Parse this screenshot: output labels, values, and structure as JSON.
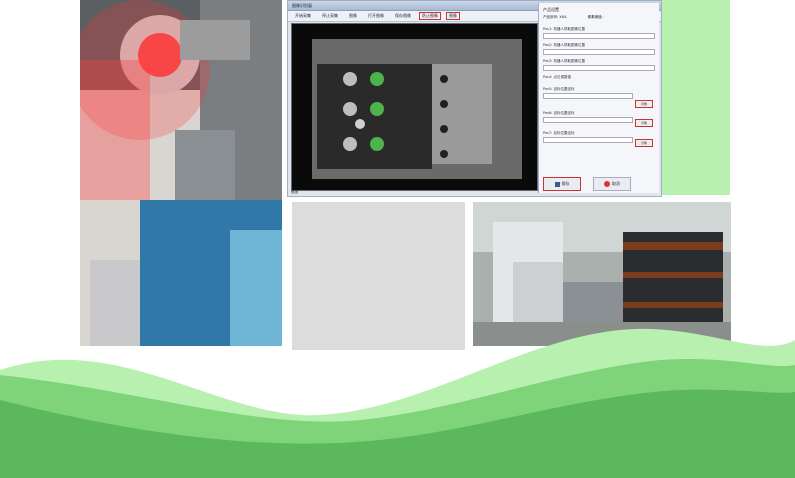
{
  "app": {
    "title": "图像识别窗",
    "menu": [
      "开始采集",
      "停止采集",
      "图像",
      "打开图像",
      "保存图像",
      "防止图像",
      "图像"
    ],
    "panel_header": "产品设置",
    "product_label": "产品序列:",
    "product_value": "XXA",
    "threshold_label": "像素阈值:",
    "fields": [
      {
        "label": "Pos1: 机器人抓取图像位置",
        "value": ""
      },
      {
        "label": "Pos2: 机器人抓取图像位置",
        "value": ""
      },
      {
        "label": "Pos3: 机器人抓取图像位置",
        "value": ""
      },
      {
        "label": "Pos4: 点位调整值",
        "value": ""
      },
      {
        "label": "Pos5: 目标位置坐标",
        "value": ""
      },
      {
        "label": "Pos6: 目标位置坐标",
        "value": ""
      },
      {
        "label": "Pos7: 目标位置坐标",
        "value": ""
      }
    ],
    "small_button": "示教",
    "save_label": "保存",
    "cancel_label": "取消",
    "status_text": "就绪"
  },
  "colors": {
    "green_light": "#b8f0b0",
    "green_mid": "#7fd47a",
    "green_dark": "#5cb85c",
    "highlight": "#d03030"
  }
}
